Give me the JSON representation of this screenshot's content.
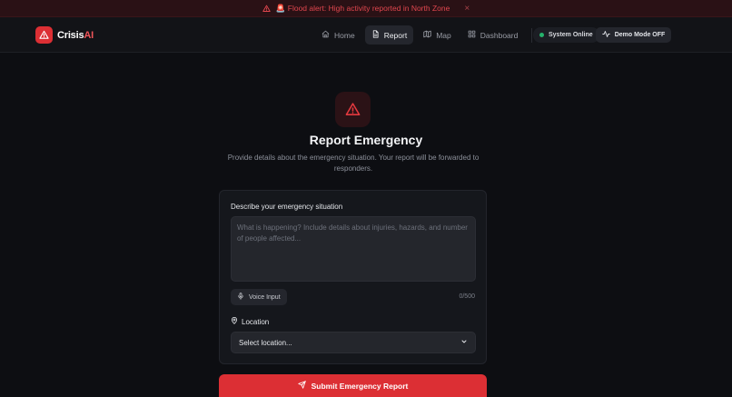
{
  "alert": {
    "text": "🚨 Flood alert: High activity reported in North Zone",
    "close": "×",
    "icon": "alert-triangle-icon",
    "color": "#e0464e"
  },
  "brand": {
    "name": "Crisis",
    "accent": "AI",
    "icon": "alert-triangle-icon",
    "color": "#dc2f34"
  },
  "nav": {
    "items": [
      {
        "label": "Home",
        "icon": "home-icon"
      },
      {
        "label": "Report",
        "icon": "file-icon",
        "active": true
      },
      {
        "label": "Map",
        "icon": "map-icon"
      },
      {
        "label": "Dashboard",
        "icon": "dashboard-icon"
      }
    ],
    "status": {
      "label": "System Online",
      "color": "#25b26b"
    },
    "demo_toggle": {
      "label": "Demo Mode OFF",
      "icon": "activity-icon"
    }
  },
  "page": {
    "title": "Report Emergency",
    "subtitle": "Provide details about the emergency situation. Your report will be forwarded to responders.",
    "icon": "alert-triangle-icon"
  },
  "form": {
    "description_label": "Describe your emergency situation",
    "description_value": "",
    "description_placeholder": "What is happening? Include details about injuries, hazards, and number of people affected...",
    "voice_button": "Voice Input",
    "char_count": "0/500",
    "location_label": "Location",
    "location_selected": "Select location...",
    "submit_label": "Submit Emergency Report"
  }
}
